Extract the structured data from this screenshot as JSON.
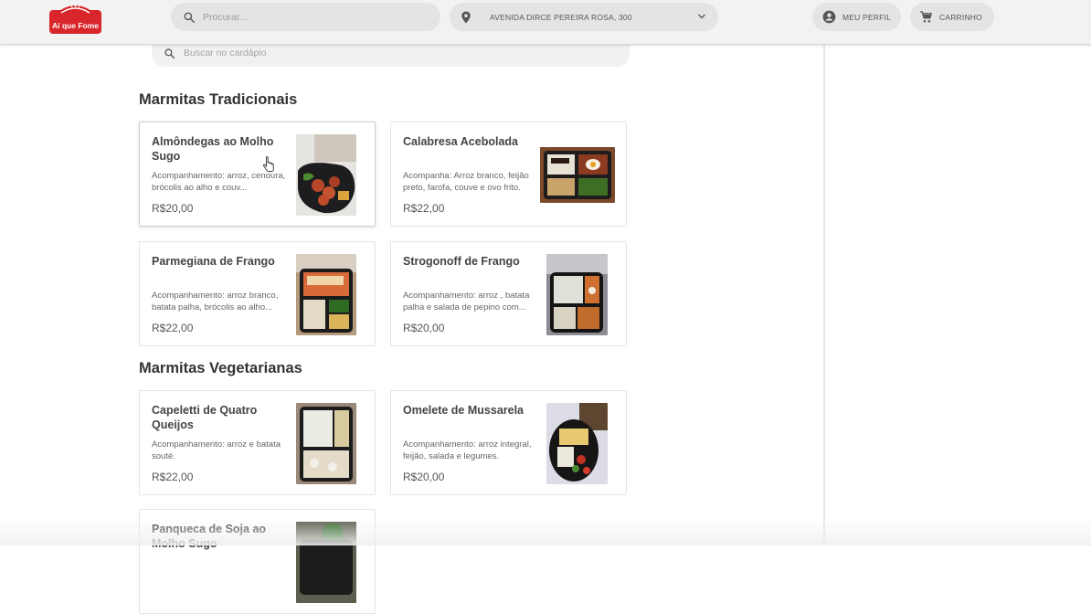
{
  "header": {
    "brand": {
      "name": "Aí que Fome",
      "color": "#d8262b"
    },
    "search": {
      "placeholder": "Procurar..."
    },
    "address": {
      "value": "AVENIDA DIRCE PEREIRA ROSA, 300"
    },
    "profile_label": "MEU PERFIL",
    "cart_label": "CARRINHO"
  },
  "menu_search": {
    "placeholder": "Buscar no cardápio"
  },
  "sections": [
    {
      "title": "Marmitas Tradicionais",
      "items": [
        {
          "name": "Almôndegas ao Molho Sugo",
          "description": "Acompanhamento: arroz, cenoura, brócolis ao alho e couv...",
          "price": "R$20,00",
          "photo": "meatballs-meal-photo"
        },
        {
          "name": "Calabresa Acebolada",
          "description": "Acompanha: Arroz branco, feijão preto, farofa, couve e ovo frito.",
          "price": "R$22,00",
          "photo": "sausage-meal-photo"
        },
        {
          "name": "Parmegiana de Frango",
          "description": "Acompanhamento: arroz branco, batata palha, brócolis ao alho...",
          "price": "R$22,00",
          "photo": "chicken-parmigiana-photo"
        },
        {
          "name": "Strogonoff de Frango",
          "description": "Acompanhamento: arroz , batata palha e salada de pepino com...",
          "price": "R$20,00",
          "photo": "stroganoff-meal-photo"
        }
      ]
    },
    {
      "title": "Marmitas Vegetarianas",
      "items": [
        {
          "name": "Capeletti de Quatro Queijos",
          "description": "Acompanhamento: arroz e batata souté.",
          "price": "R$22,00",
          "photo": "capeletti-meal-photo"
        },
        {
          "name": "Omelete de Mussarela",
          "description": "Acompanhamento: arroz integral, feijão, salada e legumes.",
          "price": "R$20,00",
          "photo": "omelette-meal-photo"
        },
        {
          "name": "Panqueca de Soja ao Molho Sugo",
          "description": "",
          "price": "",
          "photo": "soy-pancake-photo"
        }
      ]
    }
  ],
  "icons": {
    "search": "search-icon",
    "location": "location-pin-icon",
    "chevron": "chevron-down-icon",
    "profile": "account-circle-icon",
    "cart": "cart-icon"
  }
}
